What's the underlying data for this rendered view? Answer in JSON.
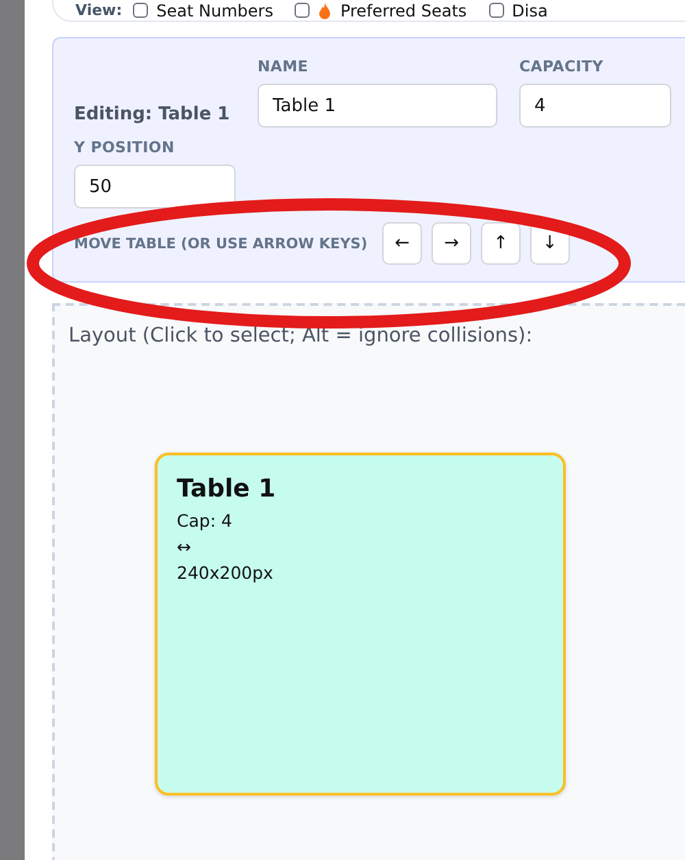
{
  "toolbar": {
    "label": "View:",
    "options": [
      {
        "label": "Seat Numbers",
        "checked": false,
        "kind": "plain"
      },
      {
        "label": "Preferred Seats",
        "checked": false,
        "kind": "flame"
      },
      {
        "label": "Disa",
        "checked": false,
        "kind": "plain"
      }
    ]
  },
  "editor": {
    "heading": "Editing: Table 1",
    "fields": [
      {
        "label": "NAME",
        "value": "Table 1"
      },
      {
        "label": "CAPACITY",
        "value": "4"
      },
      {
        "label": "Y POSITION",
        "value": "50"
      }
    ],
    "move": {
      "label": "MOVE TABLE (OR USE ARROW KEYS)",
      "buttons": [
        "←",
        "→",
        "↑",
        "↓"
      ]
    }
  },
  "annotations": [
    {
      "kind": "ellipse"
    }
  ],
  "layout": {
    "hint": "Layout (Click to select; Alt = ignore collisions):",
    "tables": [
      {
        "name": "Table 1",
        "capacity": "Cap: 4",
        "resize": "↔",
        "size": "240x200px",
        "selected": true
      }
    ]
  }
}
